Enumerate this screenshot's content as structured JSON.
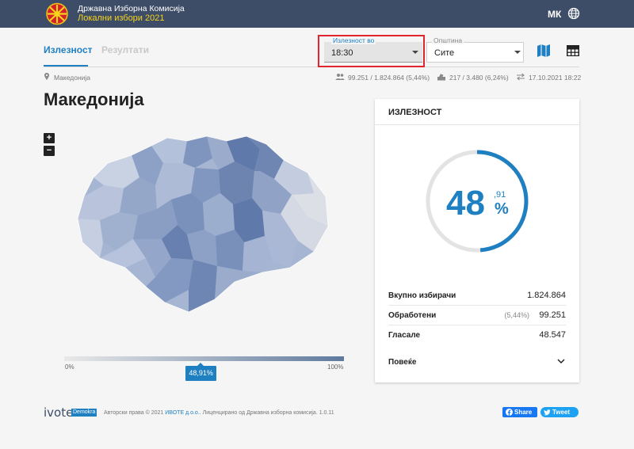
{
  "header": {
    "org_name": "Државна Изборна Комисија",
    "election_name": "Локални избори 2021",
    "language": "МК",
    "colors": {
      "bar": "#3d4c67",
      "election_name": "#f5d31b"
    }
  },
  "tabs": [
    {
      "label": "Излезност",
      "active": true
    },
    {
      "label": "Резултати",
      "active": false
    }
  ],
  "filters": {
    "time": {
      "label": "Излезност во",
      "value": "18:30"
    },
    "municipality": {
      "label": "Општина",
      "value": "Сите"
    }
  },
  "view_icons": [
    "map-icon",
    "table-icon"
  ],
  "info": {
    "location": "Македонија",
    "voters": "99.251 / 1.824.864 (5,44%)",
    "stations": "217 / 3.480 (6,24%)",
    "updated": "17.10.2021 18:22"
  },
  "page_title": "Македонија",
  "zoom": {
    "in": "+",
    "out": "−"
  },
  "legend": {
    "min": "0%",
    "max": "100%",
    "marker": "48,91%",
    "marker_fraction": 0.4891,
    "colors": {
      "low": "#e9e9e9",
      "high": "#5f7a9e"
    }
  },
  "card": {
    "title": "ИЗЛЕЗНОСТ",
    "percent_int": "48",
    "percent_dec": ",91",
    "percent_sign": "%",
    "percent_value": 48.91,
    "accent": "#1e7fc1",
    "rows": [
      {
        "label": "Вкупно избирачи",
        "value": "1.824.864",
        "extra": ""
      },
      {
        "label": "Обработени",
        "value": "99.251",
        "extra": "(5,44%)"
      },
      {
        "label": "Гласале",
        "value": "48.547",
        "extra": ""
      }
    ],
    "more_label": "Повеќе"
  },
  "footer": {
    "logo": "ivote",
    "badge": "Demokra",
    "copyright_prefix": "Авторски права © 2021",
    "company": "ИВОТЕ д.о.о.",
    "copyright_suffix": ". Лиценцирано од Државна изборна комисија. 1.0.11",
    "share_facebook": "Share",
    "share_twitter": "Tweet"
  }
}
